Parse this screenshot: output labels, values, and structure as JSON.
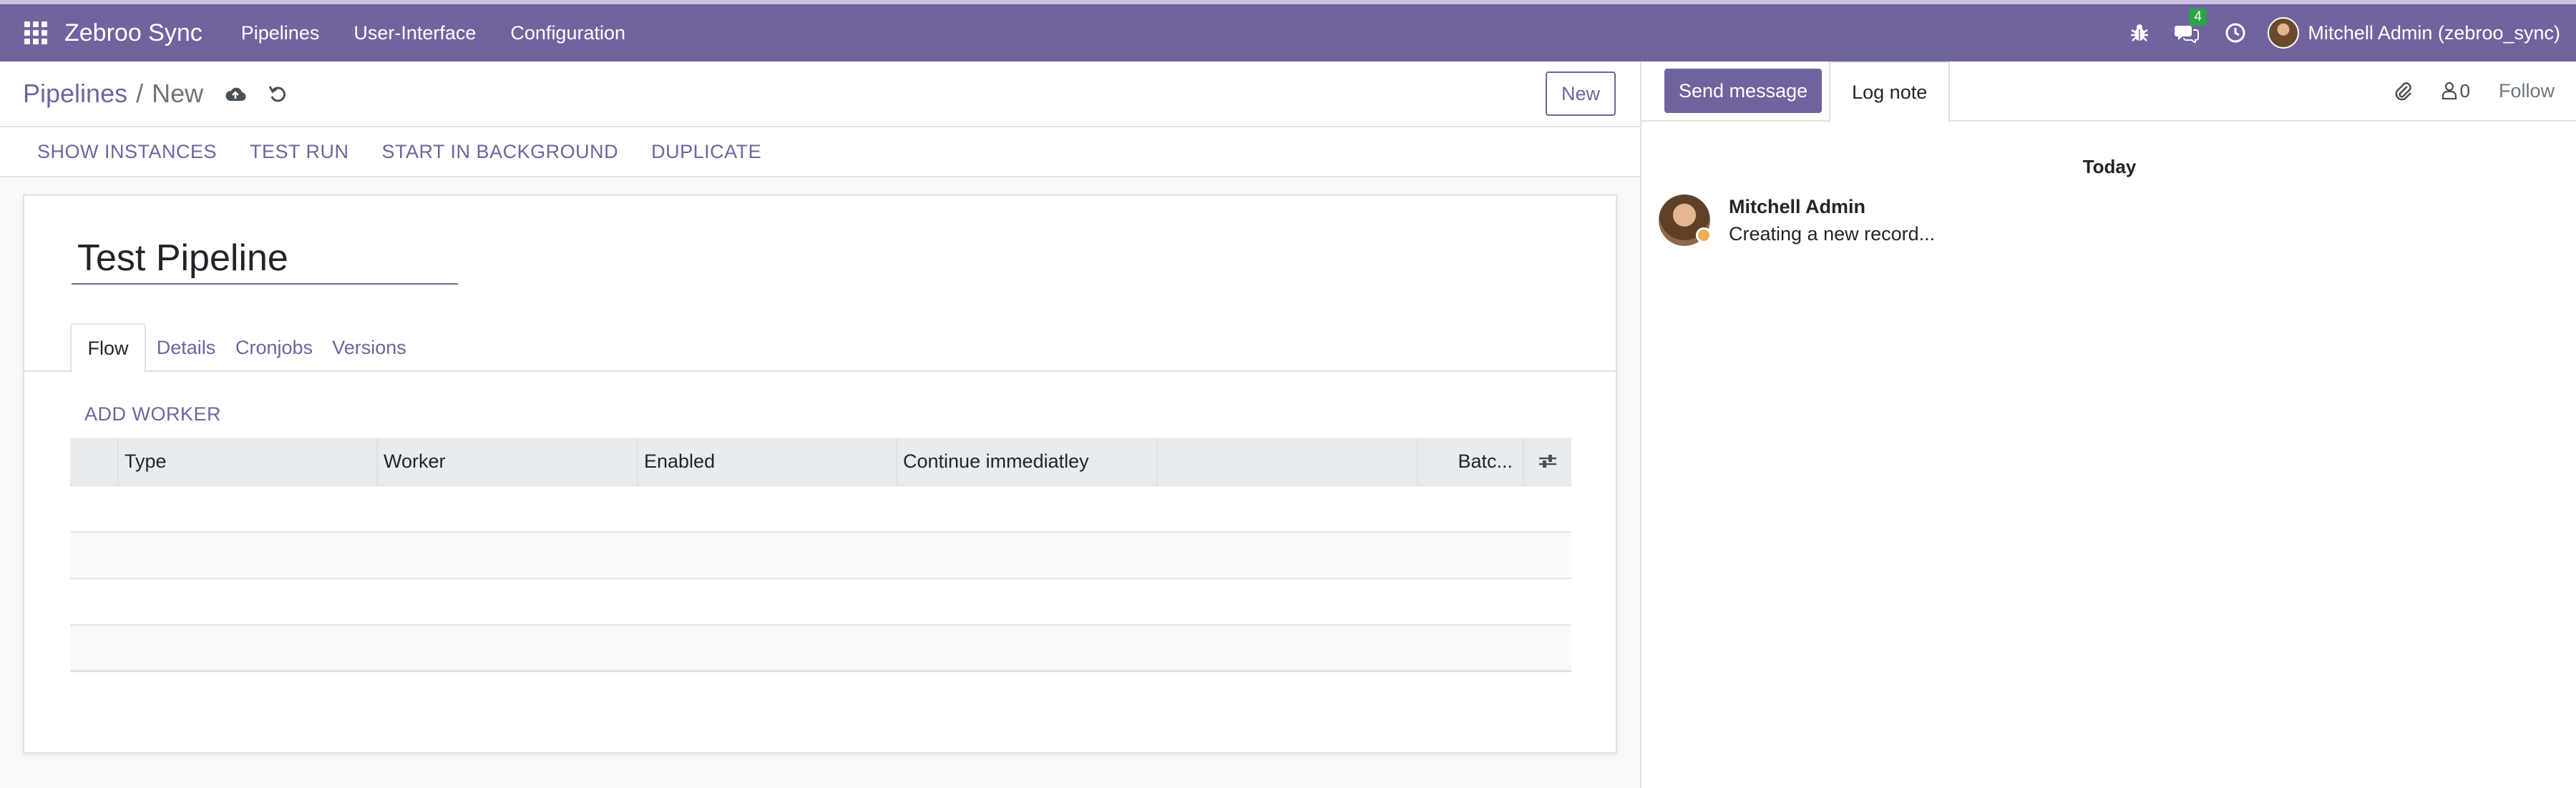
{
  "app": {
    "brand": "Zebroo Sync",
    "menu": [
      "Pipelines",
      "User-Interface",
      "Configuration"
    ],
    "messages_badge": "4",
    "user_name": "Mitchell Admin (zebroo_sync)"
  },
  "breadcrumb": {
    "parent": "Pipelines",
    "separator": "/",
    "current": "New"
  },
  "control_panel": {
    "new_label": "New"
  },
  "button_bar": [
    "SHOW INSTANCES",
    "TEST RUN",
    "START IN BACKGROUND",
    "DUPLICATE"
  ],
  "form": {
    "name": "Test Pipeline",
    "tabs": [
      "Flow",
      "Details",
      "Cronjobs",
      "Versions"
    ],
    "active_tab": "Flow",
    "add_worker_label": "ADD WORKER",
    "columns": [
      "",
      "Type",
      "Worker",
      "Enabled",
      "Continue immediatley",
      "",
      "Batc...",
      ""
    ]
  },
  "chatter": {
    "send_message": "Send message",
    "log_note": "Log note",
    "followers_count": "0",
    "follow_label": "Follow",
    "date_separator": "Today",
    "messages": [
      {
        "author": "Mitchell Admin",
        "body": "Creating a new record..."
      }
    ]
  },
  "colors": {
    "primary": "#71639e",
    "badge": "#28a745",
    "presence": "#f0ad4e"
  },
  "icons": [
    "apps-grid-icon",
    "bug-icon",
    "chat-icon",
    "clock-icon",
    "cloud-upload-icon",
    "undo-icon",
    "paperclip-icon",
    "user-icon",
    "column-settings-icon"
  ]
}
